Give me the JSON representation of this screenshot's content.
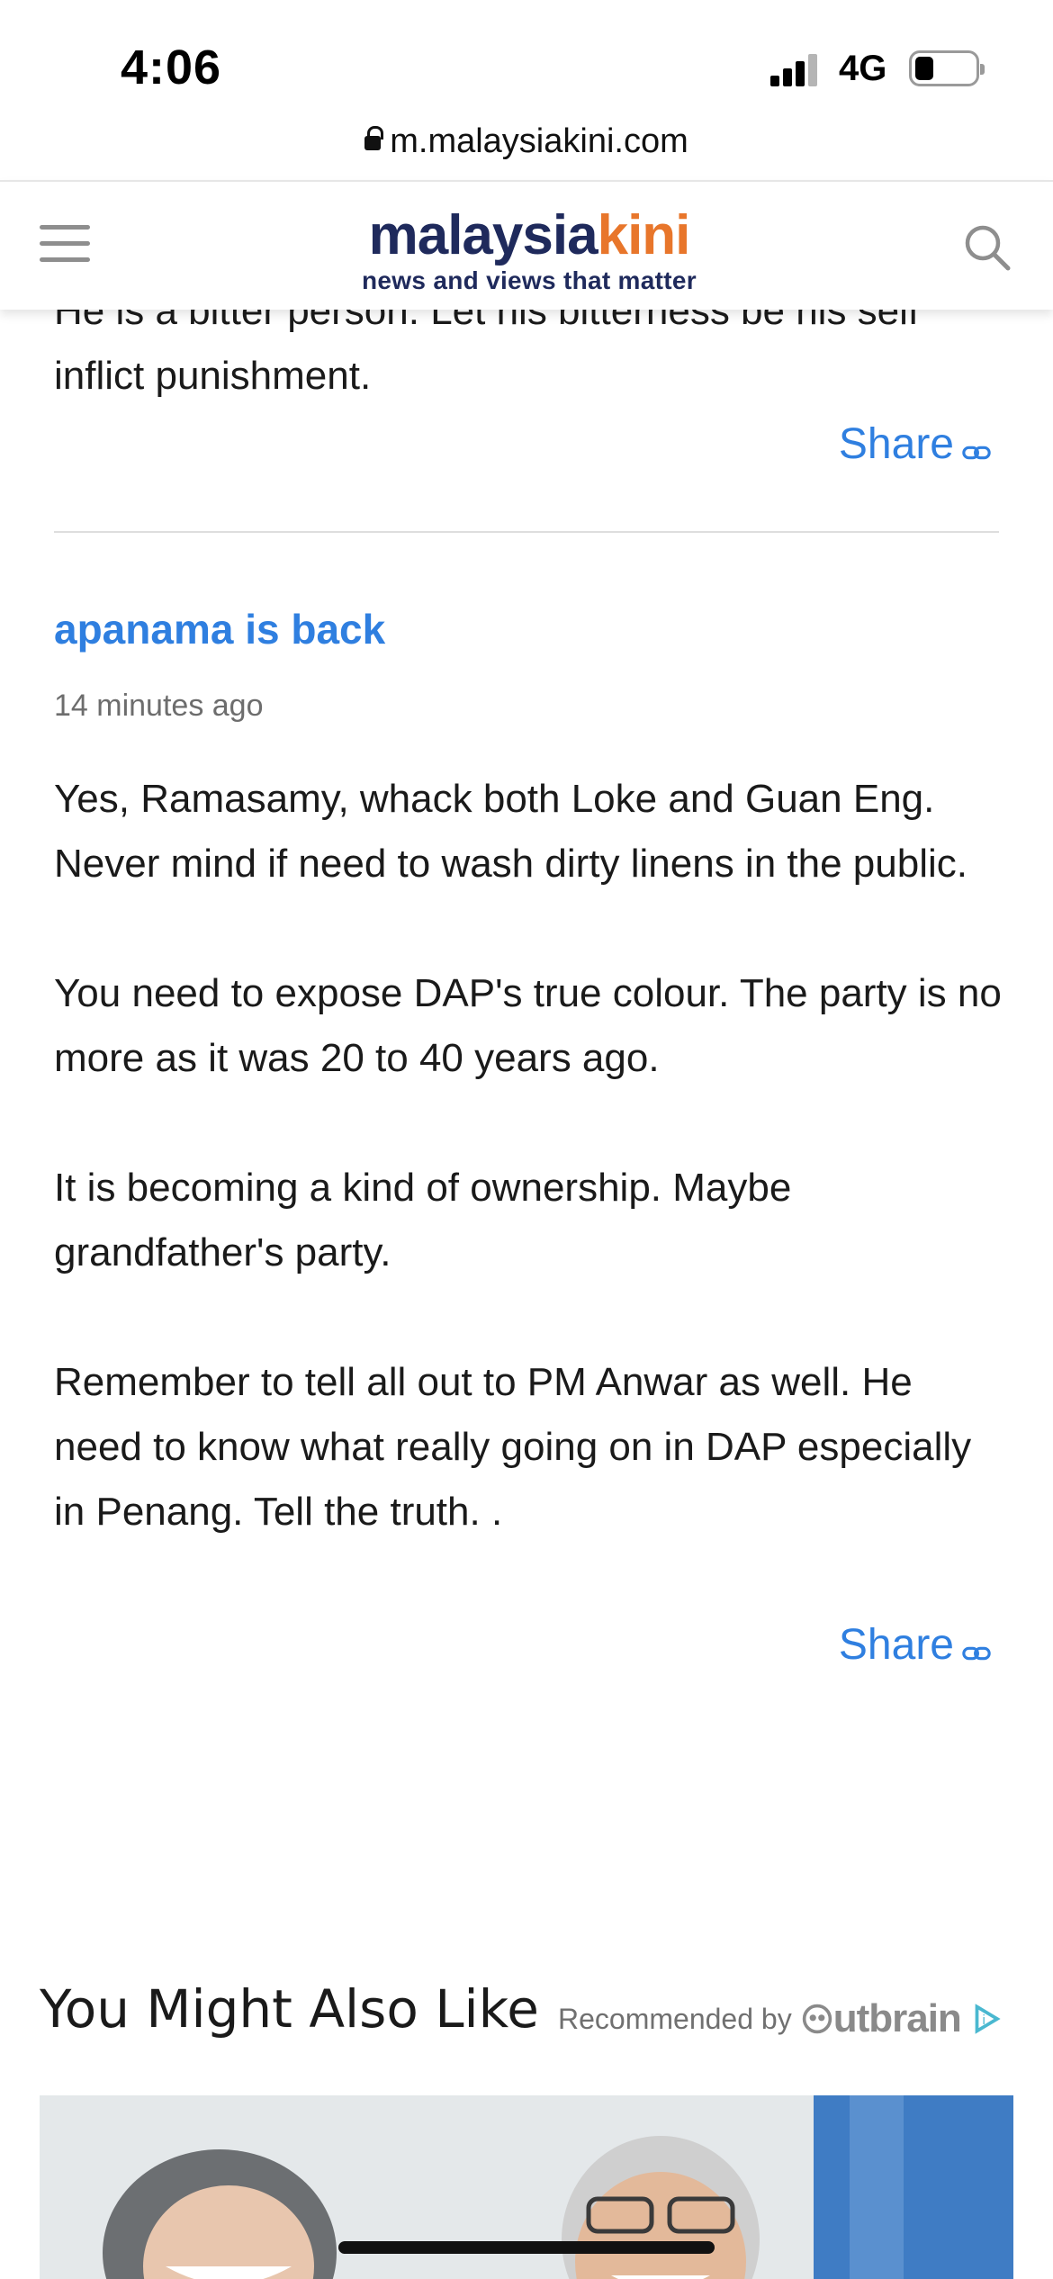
{
  "status_bar": {
    "time": "4:06",
    "network": "4G",
    "signal_icon": "signal-bars-icon",
    "battery_icon": "battery-low-icon"
  },
  "browser": {
    "url": "m.malaysiakini.com",
    "lock_icon": "lock-icon"
  },
  "header": {
    "logo_part1": "malaysia",
    "logo_part2": "kini",
    "tagline": "news and views that matter",
    "menu_icon": "hamburger-menu-icon",
    "search_icon": "search-icon",
    "colors": {
      "logo_navy": "#1f2a5c",
      "logo_orange": "#e8762b"
    }
  },
  "previous_comment": {
    "text_line1": "He is a bitter person. Let his bitterness be his self",
    "text_line2": "inflict punishment.",
    "share_label": "Share"
  },
  "comment": {
    "author": "apanama is back",
    "time_ago": "14 minutes ago",
    "paragraphs": [
      "Yes, Ramasamy, whack both Loke and Guan Eng. Never mind if need to wash dirty linens in the public.",
      "You need to expose DAP's true colour. The party is no more as it was 20 to 40 years ago.",
      "It is becoming a kind of ownership. Maybe grandfather's party.",
      "Remember to tell all out to PM Anwar as well. He need to know what really going on in DAP especially in Penang. Tell the truth. ."
    ],
    "share_label": "Share"
  },
  "recommendations": {
    "title": "You Might Also Like",
    "recommended_by": "Recommended by",
    "provider": "Outbrain"
  },
  "colors": {
    "link_blue": "#2f7fe0",
    "divider": "#dedede"
  }
}
